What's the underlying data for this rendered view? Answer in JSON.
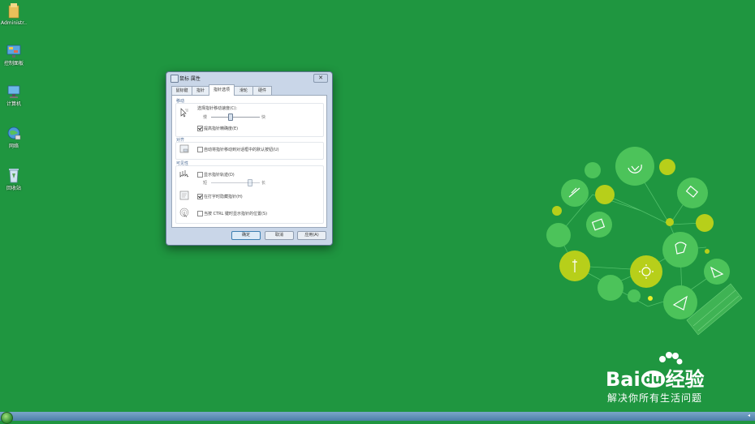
{
  "desktop_icons": [
    {
      "label": "Administr...",
      "icon": "folder-icon"
    },
    {
      "label": "控制面板",
      "icon": "control-panel-icon"
    },
    {
      "label": "计算机",
      "icon": "computer-icon"
    },
    {
      "label": "网络",
      "icon": "network-icon"
    },
    {
      "label": "回收站",
      "icon": "recycle-bin-icon"
    }
  ],
  "dialog": {
    "title": "鼠标 属性",
    "close_label": "✕",
    "tabs": [
      "鼠标键",
      "指针",
      "指针选项",
      "滑轮",
      "硬件"
    ],
    "active_tab": 2,
    "sections": {
      "motion": {
        "title": "移动",
        "speed_label": "选择指针移动速度(C):",
        "slow": "慢",
        "fast": "快",
        "speed_level": 0.4,
        "precision_label": "提高指针精确度(E)",
        "precision_checked": true
      },
      "snap": {
        "title": "对齐",
        "label": "自动将指针移动到对话框中的默认按钮(U)",
        "checked": false
      },
      "visibility": {
        "title": "可见性",
        "trails_label": "显示指针轨迹(D)",
        "trails_checked": false,
        "short": "短",
        "long": "长",
        "trails_level": 0.8,
        "hide_label": "在打字时隐藏指针(H)",
        "hide_checked": true,
        "ctrl_label": "当按 CTRL 键时显示指针的位置(S)",
        "ctrl_checked": false
      }
    },
    "buttons": {
      "ok": "确定",
      "cancel": "取消",
      "apply": "应用(A)"
    }
  },
  "logo": {
    "bai": "Bai",
    "du": "du",
    "jingyan": "经验",
    "tagline": "解决你所有生活问题"
  },
  "colors": {
    "desktop": "#1f9640",
    "light_green": "#4cc35a",
    "yellow_green": "#b7cf1a"
  }
}
